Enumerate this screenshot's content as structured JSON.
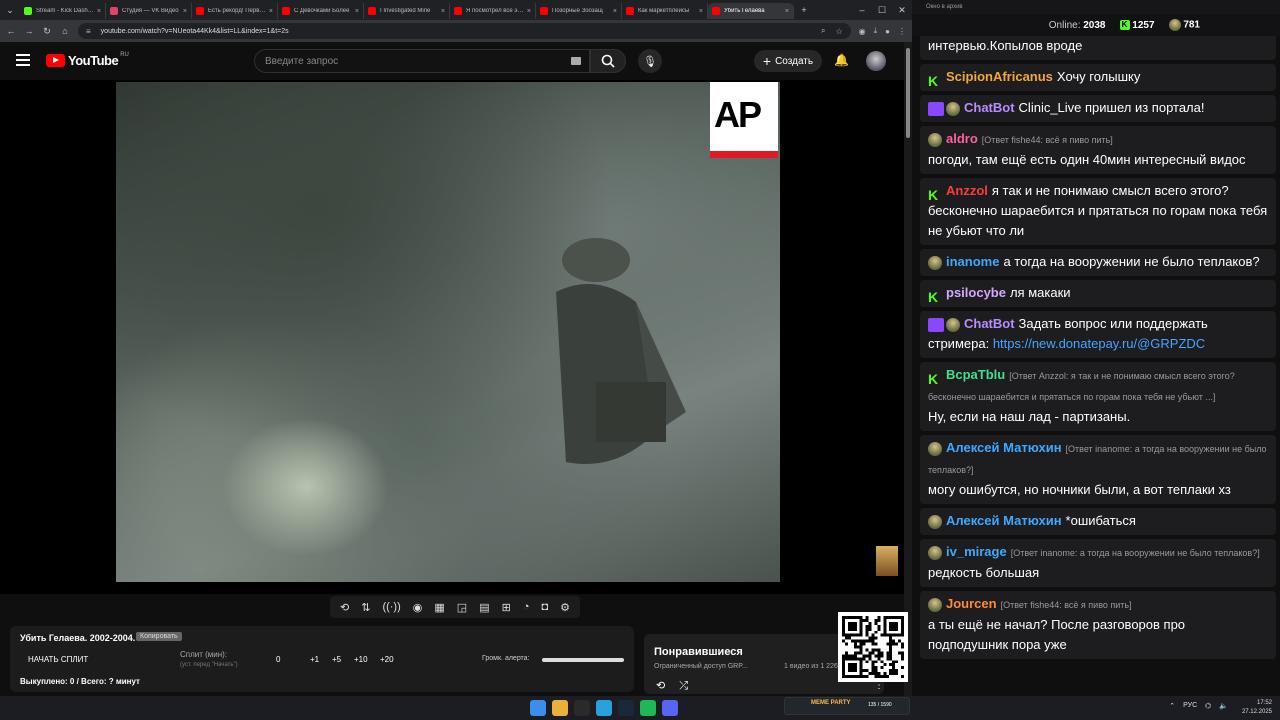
{
  "browser": {
    "tabs": [
      {
        "title": "Stream - Kick Dashboard",
        "color": "#53fc18",
        "active": false
      },
      {
        "title": "Студия — VK Видео",
        "color": "#e0426a",
        "active": false
      },
      {
        "title": "Есть рекорд! Первый",
        "color": "#ff0000",
        "active": false
      },
      {
        "title": "С Девочками Более",
        "color": "#ff0000",
        "active": false
      },
      {
        "title": "I Investigated Mine",
        "color": "#ff0000",
        "active": false
      },
      {
        "title": "Я посмотрел все эпи",
        "color": "#ff0000",
        "active": false
      },
      {
        "title": "Позорные Зоозащ",
        "color": "#ff0000",
        "active": false
      },
      {
        "title": "Как маркетплейсы",
        "color": "#ff0000",
        "active": false
      },
      {
        "title": "Убить Гелаева",
        "color": "#ff0000",
        "active": true
      }
    ],
    "url": "youtube.com/watch?v=NUeota44Kk4&list=LL&index=1&t=2s"
  },
  "youtube": {
    "logo": "YouTube",
    "region": "RU",
    "search_placeholder": "Введите запрос",
    "create_label": "Создать",
    "icons": [
      "menu-icon",
      "search-icon",
      "mic-icon",
      "plus-icon",
      "bell-icon"
    ]
  },
  "video": {
    "watermark": "AP"
  },
  "panel": {
    "title": "Убить Гелаева. 2002-2004.",
    "copy_label": "Копировать",
    "split_button": "НАЧАТЬ СПЛИТ",
    "split_label": "Сплит (мин):",
    "split_sub": "(уст. перед \"Начать\")",
    "split_values": [
      "0",
      "+1",
      "+5",
      "+10",
      "+20"
    ],
    "volume_label": "Громк. алерта:",
    "bought": "Выкуплено: 0 / Всего: ? минут"
  },
  "liked": {
    "title": "Понравившиеся",
    "subtitle": "Ограниченный доступ GRP...",
    "count": "1 видео из 1 226"
  },
  "chat": {
    "header": "Окно в архив",
    "online_label": "Online:",
    "online": "2038",
    "stat1": "1257",
    "stat2": "781",
    "messages": [
      {
        "name": "",
        "color": "#fff",
        "badges": [],
        "reply": "",
        "text": "интервью.Копылов вроде",
        "link": ""
      },
      {
        "name": "ScipionAfricanus",
        "color": "#f2a93b",
        "badges": [
          "k"
        ],
        "reply": "",
        "text": "Хочу голышку",
        "link": ""
      },
      {
        "name": "ChatBot",
        "color": "#b98cff",
        "badges": [
          "bot",
          "av"
        ],
        "reply": "",
        "text": "Clinic_Live пришел из портала!",
        "link": "",
        "mention": "Clinic_Live"
      },
      {
        "name": "aldro",
        "color": "#ff5fa2",
        "badges": [
          "av"
        ],
        "reply": "[Ответ fishe44: всё я пиво пить]",
        "text": "погоди, там ещё есть один 40мин интересный видос",
        "link": ""
      },
      {
        "name": "Anzzol",
        "color": "#ff3b3b",
        "badges": [
          "k"
        ],
        "reply": "",
        "text": "я так и не понимаю смысл всего этого? бесконечно шараебится и прятаться по горам пока тебя не убьют что ли",
        "link": ""
      },
      {
        "name": "inanome",
        "color": "#3fa9ff",
        "badges": [
          "av"
        ],
        "reply": "",
        "text": "а тогда на вооружении не было теплаков?",
        "link": ""
      },
      {
        "name": "psilocybe",
        "color": "#d6a6ff",
        "badges": [
          "k"
        ],
        "reply": "",
        "text": "ля макаки",
        "link": ""
      },
      {
        "name": "ChatBot",
        "color": "#b98cff",
        "badges": [
          "bot",
          "av"
        ],
        "reply": "",
        "text": "Задать вопрос или поддержать стримера:",
        "link": "https://new.donatepay.ru/@GRPZDC"
      },
      {
        "name": "BcpaTblu",
        "color": "#3fe08c",
        "badges": [
          "k"
        ],
        "reply": "[Ответ Anzzol: я так и не понимаю смысл всего этого? бесконечно шараебится и прятаться по горам пока тебя не убьют ...]",
        "text": "Ну, если на наш лад - партизаны.",
        "link": ""
      },
      {
        "name": "Алексей Матюхин",
        "color": "#3fa9ff",
        "badges": [
          "av"
        ],
        "reply": "[Ответ inanome: а тогда на вооружении не было теплаков?]",
        "text": "могу ошибутся, но ночники были, а вот теплаки хз",
        "link": ""
      },
      {
        "name": "Алексей Матюхин",
        "color": "#3fa9ff",
        "badges": [
          "av"
        ],
        "reply": "",
        "text": "*ошибаться",
        "link": ""
      },
      {
        "name": "iv_mirage",
        "color": "#3fa9ff",
        "badges": [
          "av"
        ],
        "reply": "[Ответ inanome: а тогда на вооружении не было теплаков?]",
        "text": "редкость большая",
        "link": ""
      },
      {
        "name": "Jourcen",
        "color": "#ff8a3b",
        "badges": [
          "av"
        ],
        "reply": "[Ответ fishe44: всё я пиво пить]",
        "text": "а ты ещё не начал? После разговоров про подподушник пора уже",
        "link": ""
      }
    ]
  },
  "taskbar": {
    "meme_label": "MEME PARTY",
    "meme_count": "135 / 1590",
    "lang": "РУС",
    "time": "17:52",
    "date": "27.12.2025",
    "icons": [
      "windows-icon",
      "chrome-icon",
      "obs-icon",
      "telegram-icon",
      "steam-icon",
      "spotify-icon",
      "discord-icon"
    ]
  }
}
